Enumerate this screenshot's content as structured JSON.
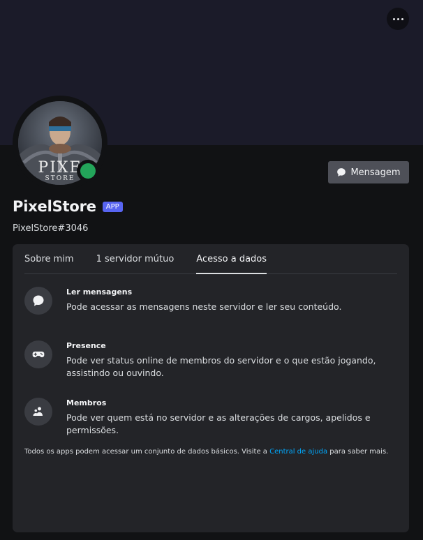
{
  "profile": {
    "display_name": "PixelStore",
    "badge": "APP",
    "username": "PixelStore#3046",
    "avatar_text_top": "PIXE",
    "avatar_text_bottom": "STORE",
    "status": "online",
    "status_color": "#23a55a"
  },
  "actions": {
    "more_icon": "more-horizontal-icon",
    "message_label": "Mensagem",
    "message_icon": "chat-bubble-icon"
  },
  "tabs": [
    {
      "label": "Sobre mim",
      "active": false
    },
    {
      "label": "1 servidor mútuo",
      "active": false
    },
    {
      "label": "Acesso a dados",
      "active": true
    }
  ],
  "permissions": [
    {
      "title": "Ler mensagens",
      "description": "Pode acessar as mensagens neste servidor e ler seu conteúdo.",
      "icon": "chat-bubble-icon"
    },
    {
      "title": "Presence",
      "description": "Pode ver status online de membros do servidor e o que estão jogando, assistindo ou ouvindo.",
      "icon": "gamepad-icon"
    },
    {
      "title": "Membros",
      "description": "Pode ver quem está no servidor e as alterações de cargos, apelidos e permissões.",
      "icon": "people-icon"
    }
  ],
  "footer": {
    "before": "Todos os apps podem acessar um conjunto de dados básicos. Visite a ",
    "link": "Central de ajuda",
    "after": " para saber mais."
  },
  "colors": {
    "accent": "#5865f2",
    "link": "#00a8fc",
    "background": "#111214",
    "banner": "#1b1b29",
    "panel": "#232428"
  }
}
